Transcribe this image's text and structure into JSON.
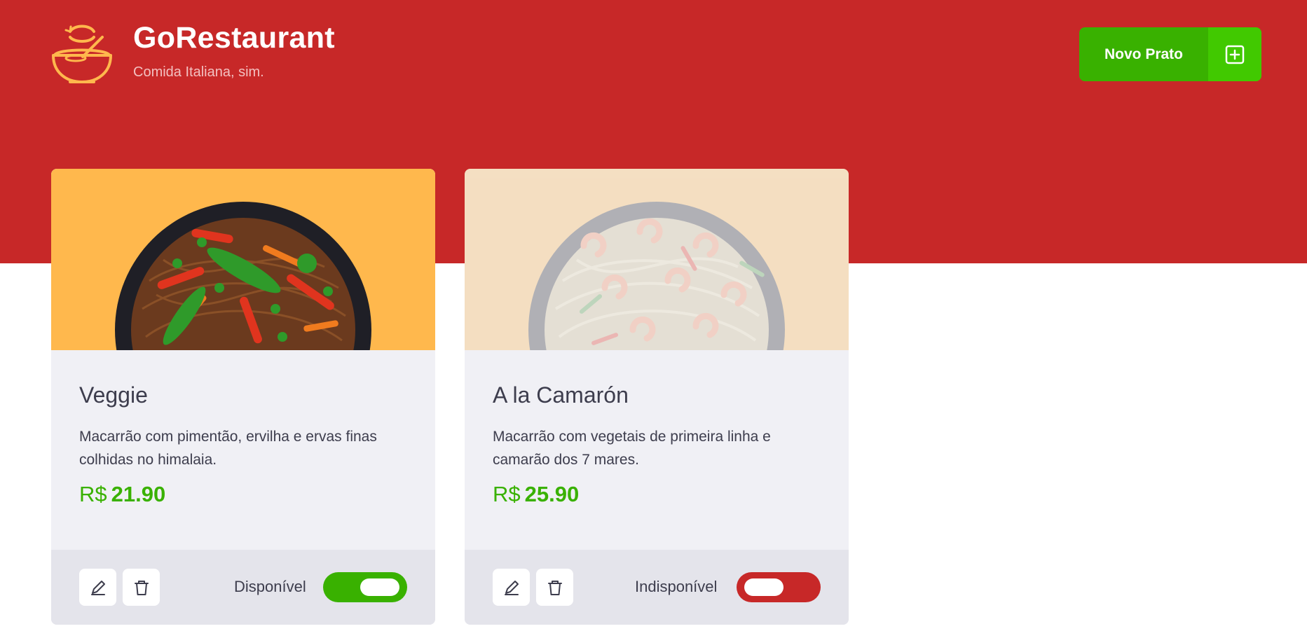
{
  "header": {
    "brand_title": "GoRestaurant",
    "brand_subtitle": "Comida Italiana, sim.",
    "logo_icon": "bowl-icon",
    "new_dish_button": {
      "label": "Novo Prato",
      "icon": "plus-square-icon"
    }
  },
  "dishes": [
    {
      "name": "Veggie",
      "description": "Macarrão com pimentão, ervilha e ervas finas colhidas no himalaia.",
      "currency": "R$",
      "price": "21.90",
      "available": true,
      "availability_label": "Disponível",
      "image_bg": "#ffb84d",
      "edit_icon": "pencil-icon",
      "delete_icon": "trash-icon"
    },
    {
      "name": "A la Camarón",
      "description": "Macarrão com vegetais de primeira linha e camarão dos 7 mares.",
      "currency": "R$",
      "price": "25.90",
      "available": false,
      "availability_label": "Indisponível",
      "image_bg": "#ffb84d",
      "edit_icon": "pencil-icon",
      "delete_icon": "trash-icon"
    }
  ],
  "colors": {
    "primary_red": "#c72828",
    "success_green": "#39b100",
    "logo_yellow": "#ffb84d",
    "card_bg": "#f0f0f5",
    "footer_bg": "#e4e4eb",
    "text_dark": "#3d3d4d"
  }
}
